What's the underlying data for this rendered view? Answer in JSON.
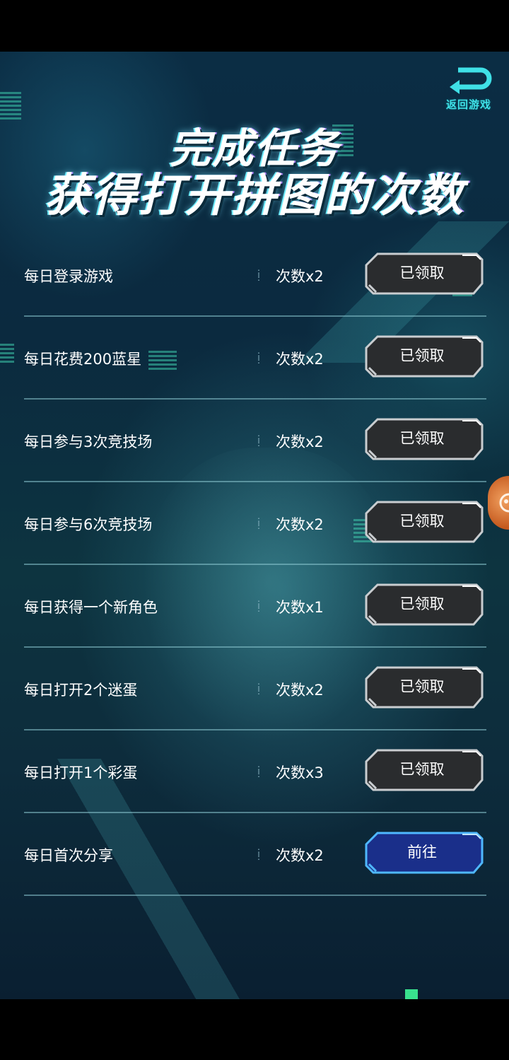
{
  "header": {
    "return_label": "返回游戏",
    "title_line1": "完成任务",
    "title_line2": "获得打开拼图的次数"
  },
  "tasks": [
    {
      "name": "每日登录游戏",
      "reward": "次数x2",
      "button": "已领取",
      "state": "claimed"
    },
    {
      "name": "每日花费200蓝星",
      "reward": "次数x2",
      "button": "已领取",
      "state": "claimed"
    },
    {
      "name": "每日参与3次竞技场",
      "reward": "次数x2",
      "button": "已领取",
      "state": "claimed"
    },
    {
      "name": "每日参与6次竞技场",
      "reward": "次数x2",
      "button": "已领取",
      "state": "claimed"
    },
    {
      "name": "每日获得一个新角色",
      "reward": "次数x1",
      "button": "已领取",
      "state": "claimed"
    },
    {
      "name": "每日打开2个迷蛋",
      "reward": "次数x2",
      "button": "已领取",
      "state": "claimed"
    },
    {
      "name": "每日打开1个彩蛋",
      "reward": "次数x3",
      "button": "已领取",
      "state": "claimed"
    },
    {
      "name": "每日首次分享",
      "reward": "次数x2",
      "button": "前往",
      "state": "go"
    }
  ],
  "colors": {
    "claimed_fill": "#2a2c2e",
    "claimed_border": "#c9cdd0",
    "go_fill": "#1a2f8a",
    "go_border": "#4fb8ff",
    "accent_cyan": "#3fe0e6"
  },
  "icons": {
    "return": "return-arrow-icon",
    "float": "joystick-icon"
  }
}
